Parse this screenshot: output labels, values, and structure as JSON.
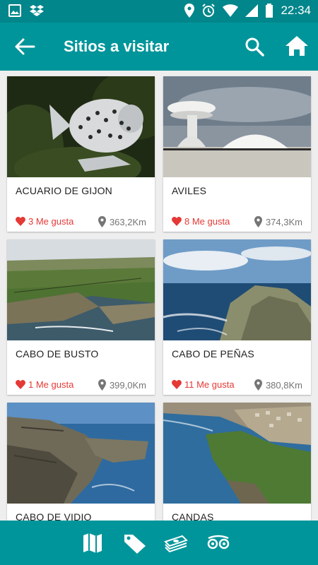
{
  "app": {
    "title": "Sitios a visitar"
  },
  "status": {
    "time": "22:34"
  },
  "sites": [
    {
      "name": "ACUARIO DE GIJON",
      "likes": "3 Me gusta",
      "distance": "363,2Km"
    },
    {
      "name": "AVILES",
      "likes": "8 Me gusta",
      "distance": "374,3Km"
    },
    {
      "name": "CABO DE BUSTO",
      "likes": "1 Me gusta",
      "distance": "399,0Km"
    },
    {
      "name": "CABO DE PEÑAS",
      "likes": "11 Me gusta",
      "distance": "380,8Km"
    },
    {
      "name": "CABO DE VIDIO",
      "likes": "",
      "distance": ""
    },
    {
      "name": "CANDAS",
      "likes": "",
      "distance": ""
    }
  ],
  "colors": {
    "primary": "#00959a",
    "statusbar": "#00868b",
    "like": "#e53935",
    "distance": "#757575"
  },
  "icons": {
    "appbar": [
      "back-arrow-icon",
      "search-icon",
      "home-icon"
    ],
    "bottom_nav": [
      "map-icon",
      "tag-icon",
      "money-icon",
      "tripadvisor-icon"
    ]
  }
}
